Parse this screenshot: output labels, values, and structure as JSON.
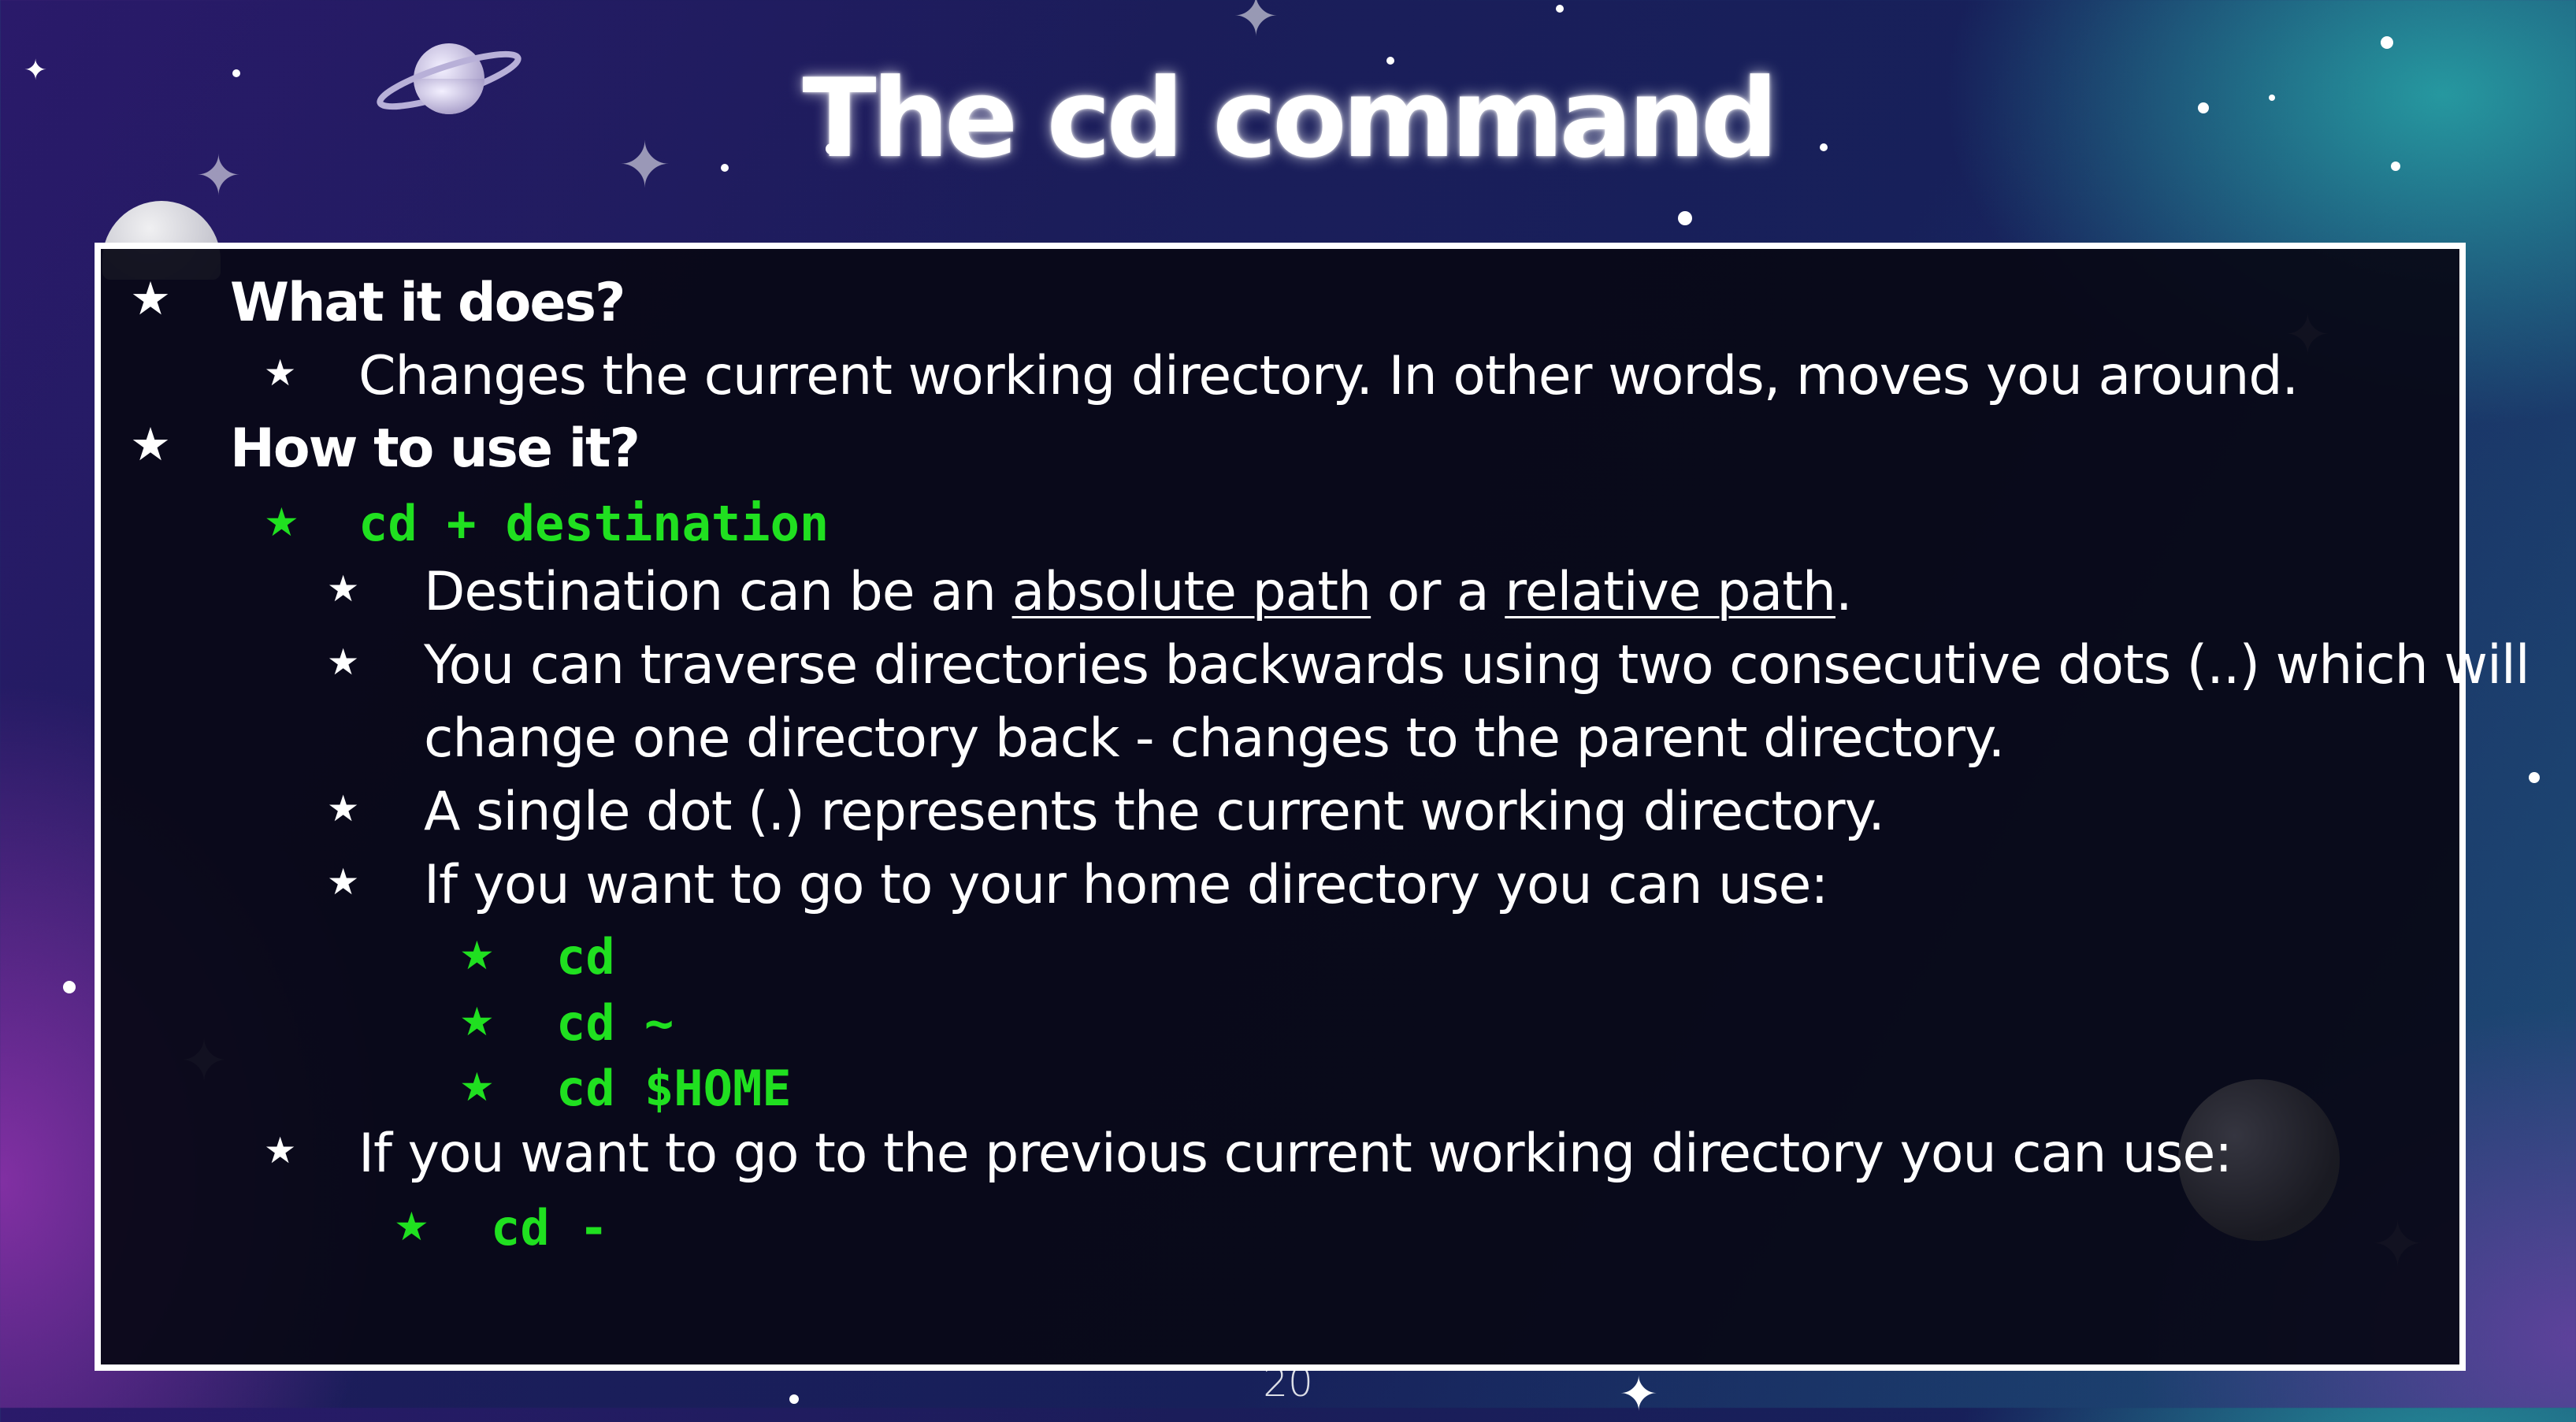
{
  "slide": {
    "title": "The cd command",
    "page_number": "20"
  },
  "content": {
    "bullet_glyph": "★",
    "q1": "What it does?",
    "q1_answer": "Changes the current working directory. In other words, moves you around.",
    "q2": "How to use it?",
    "syntax": "cd + destination",
    "dest_pre": "Destination can be an ",
    "dest_abs": "absolute path",
    "dest_mid": " or a ",
    "dest_rel": "relative path",
    "dest_post": ".",
    "traverse_line1": "You can traverse directories backwards using two consecutive dots (..) which will",
    "traverse_line2": "change one directory back - changes to the parent directory.",
    "single_dot": "A single dot (.) represents the current working directory.",
    "home_intro": "If you want to go to your home directory you can use:",
    "home_cmd1": "cd",
    "home_cmd2": "cd ~",
    "home_cmd3": "cd $HOME",
    "prev_intro": "If you want to go to the previous current working directory you can use:",
    "prev_cmd": "cd -"
  },
  "colors": {
    "code_green": "#20e020",
    "panel_bg": "#08081a",
    "panel_border": "#ffffff"
  }
}
